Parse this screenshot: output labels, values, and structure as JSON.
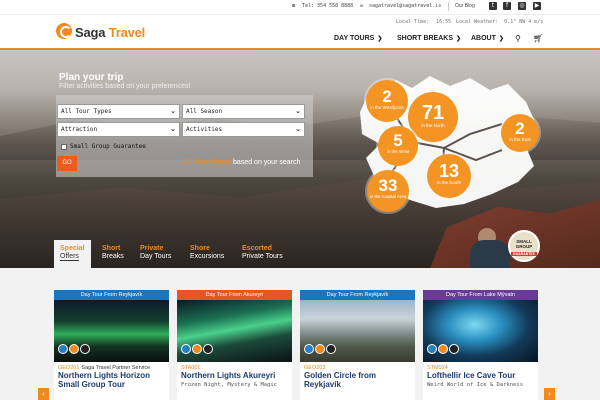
{
  "topbar": {
    "tel": "Tel: 354 558 8888",
    "email": "sagatravel@sagatravel.is",
    "blog": "Our Blog",
    "local_time_label": "Local Time:",
    "local_time": "16:55",
    "weather_label": "Local Weather:",
    "weather": "0.1° NW 4 m/s",
    "social_icons": [
      "twitter-icon",
      "facebook-icon",
      "instagram-icon",
      "youtube-icon"
    ]
  },
  "header": {
    "logo_saga": "Saga",
    "logo_travel": "Travel",
    "nav": [
      "DAY TOURS",
      "SHORT BREAKS",
      "ABOUT"
    ]
  },
  "hero": {
    "title": "Plan your trip",
    "subtitle": "Filter activities based on your preferences!",
    "filters": {
      "tour_type": "All Tour Types",
      "season": "All Season",
      "attraction": "Attraction",
      "activity": "Activities"
    },
    "checkbox_label": "Small Group Guarantee",
    "go_label": "GO",
    "found_number": "225 Tours found",
    "found_text": "based on your search"
  },
  "regions": [
    {
      "count": "2",
      "label": "in the Westfjords"
    },
    {
      "count": "71",
      "label": "in the North"
    },
    {
      "count": "5",
      "label": "in the West"
    },
    {
      "count": "2",
      "label": "in the East"
    },
    {
      "count": "13",
      "label": "in the South"
    },
    {
      "count": "33",
      "label": "in the Capital Area"
    }
  ],
  "badge": {
    "line1": "SMALL",
    "line2": "GROUP",
    "line3": "GUARANTEE"
  },
  "tabs": [
    {
      "a": "Special",
      "b": "Offers"
    },
    {
      "a": "Short",
      "b": "Breaks"
    },
    {
      "a": "Private",
      "b": "Day Tours"
    },
    {
      "a": "Shore",
      "b": "Excursions"
    },
    {
      "a": "Escorted",
      "b": "Private Tours"
    }
  ],
  "cards": [
    {
      "head": "Day Tour From Reykjavík",
      "code": "GEO201",
      "code_sub": "Saga Travel Partner Service",
      "title": "Northern Lights Horizon Small Group Tour",
      "sub": "",
      "color": "#1a76c0"
    },
    {
      "head": "Day Tour From Akureyri",
      "code": "STA001",
      "code_sub": "",
      "title": "Northern Lights Akureyri",
      "sub": "Frozen Night, Mystery & Magic",
      "color": "#e2581f"
    },
    {
      "head": "Day Tour From Reykjavík",
      "code": "GEO203",
      "code_sub": "",
      "title": "Golden Circle from Reykjavík",
      "sub": "",
      "color": "#1a76c0"
    },
    {
      "head": "Day Tour From Lake Mývatn",
      "code": "STM024",
      "code_sub": "",
      "title": "Lofthellir Ice Cave Tour",
      "sub": "Weird World of Ice & Darkness",
      "color": "#6a3a9a"
    }
  ],
  "colors": {
    "accent": "#f08a1c",
    "navy": "#1e3a6e"
  }
}
